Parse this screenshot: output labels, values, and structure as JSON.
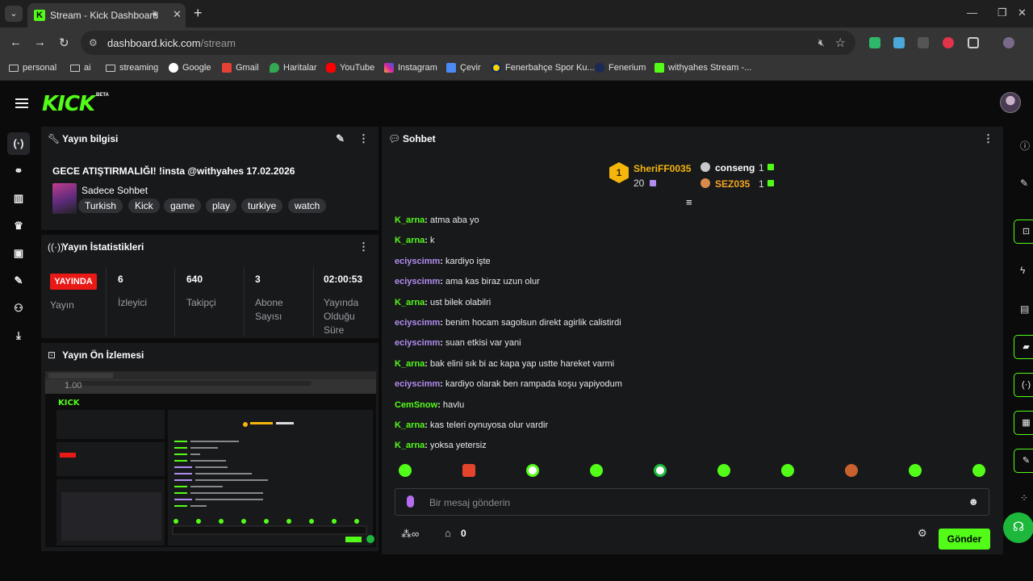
{
  "browser": {
    "tab": {
      "title": "Stream - Kick Dashboard"
    },
    "url": {
      "host": "dashboard.kick.com",
      "path": "/stream"
    },
    "bookmarks": [
      "personal",
      "ai",
      "streaming",
      "Google",
      "Gmail",
      "Haritalar",
      "YouTube",
      "Instagram",
      "Çevir",
      "Fenerbahçe Spor Ku...",
      "Fenerium",
      "withyahes Stream -..."
    ]
  },
  "app": {
    "logo": "KICK",
    "beta": "BETA"
  },
  "stream_info": {
    "header": "Yayın bilgisi",
    "title": "GECE ATIŞTIRMALIĞI! !insta @withyahes 17.02.2026",
    "category": "Sadece Sohbet",
    "tags": [
      "Turkish",
      "Kick",
      "game",
      "play",
      "turkiye",
      "watch"
    ]
  },
  "stats": {
    "header": "Yayın İstatistikleri",
    "live_badge": "YAYINDA",
    "live_label": "Yayın",
    "viewers": {
      "value": "6",
      "label": "İzleyici"
    },
    "followers": {
      "value": "640",
      "label": "Takipçi"
    },
    "subs": {
      "value": "3",
      "label": "Abone Sayısı"
    },
    "uptime": {
      "value": "02:00:53",
      "label": "Yayında Olduğu Süre"
    }
  },
  "preview": {
    "header": "Yayın Ön İzlemesi",
    "overlay": "1.00"
  },
  "chat": {
    "header": "Sohbet",
    "leaderboard": {
      "first": {
        "rank": "1",
        "name": "SheriFF0035",
        "count": "20"
      },
      "second": {
        "name": "conseng",
        "count": "1"
      },
      "third": {
        "name": "SEZ035",
        "count": "1"
      }
    },
    "messages": [
      {
        "user": "K_arna",
        "text": "atma aba yo",
        "color": "#53fc18"
      },
      {
        "user": "K_arna",
        "text": "k",
        "color": "#53fc18"
      },
      {
        "user": "eciyscimm",
        "text": "kardiyo işte",
        "color": "#b08cf0"
      },
      {
        "user": "eciyscimm",
        "text": "ama kas biraz uzun olur",
        "color": "#b08cf0"
      },
      {
        "user": "K_arna",
        "text": "ust bilek olabilri",
        "color": "#53fc18"
      },
      {
        "user": "eciyscimm",
        "text": "benim hocam sagolsun direkt agirlik calistirdi",
        "color": "#b08cf0"
      },
      {
        "user": "eciyscimm",
        "text": "suan etkisi var yani",
        "color": "#b08cf0"
      },
      {
        "user": "K_arna",
        "text": "bak elini sık bi ac kapa yap ustte hareket varmi",
        "color": "#53fc18"
      },
      {
        "user": "eciyscimm",
        "text": "kardiyo olarak ben rampada koşu yapiyodum",
        "color": "#b08cf0"
      },
      {
        "user": "CemSnow",
        "text": "havlu",
        "color": "#53fc18"
      },
      {
        "user": "K_arna",
        "text": "kas teleri oynuyosa olur vardir",
        "color": "#53fc18"
      },
      {
        "user": "K_arna",
        "text": "yoksa yetersiz",
        "color": "#53fc18"
      }
    ],
    "input_placeholder": "Bir mesaj gönderin",
    "points": "0",
    "send_label": "Gönder"
  },
  "colors": {
    "accent": "#53fc18",
    "live": "#e91916",
    "panel": "#18191b",
    "background": "#0b0b0c"
  }
}
